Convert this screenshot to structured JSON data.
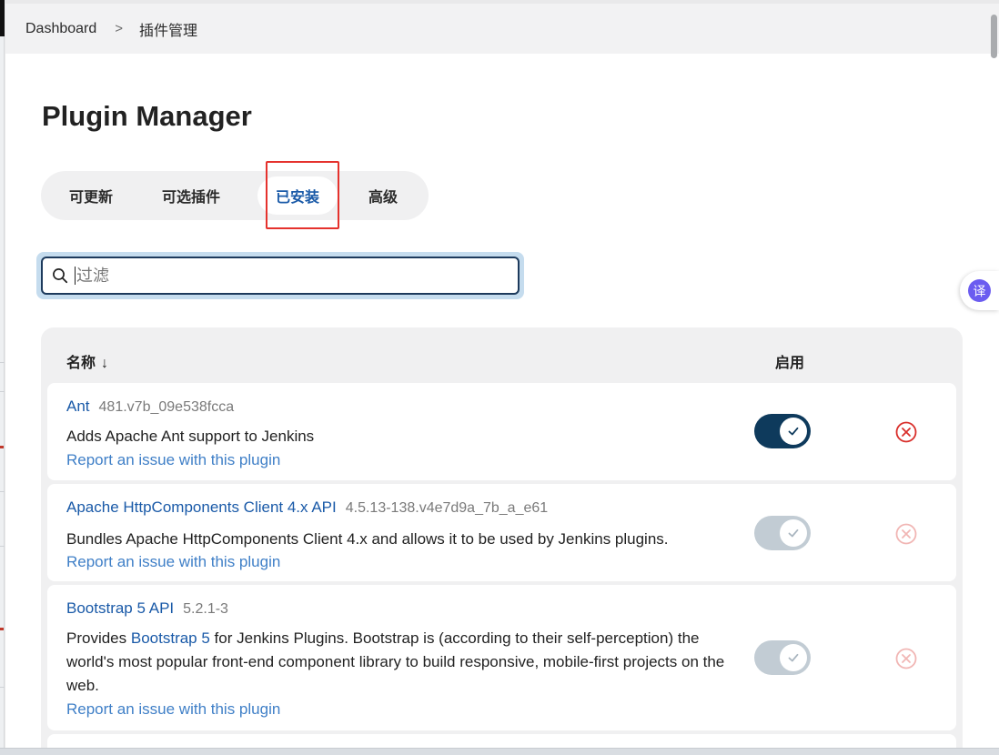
{
  "breadcrumb": {
    "items": [
      "Dashboard",
      "插件管理"
    ],
    "separator": ">"
  },
  "page": {
    "title": "Plugin Manager"
  },
  "tabs": [
    {
      "label": "可更新",
      "active": false
    },
    {
      "label": "可选插件",
      "active": false
    },
    {
      "label": "已安装",
      "active": true
    },
    {
      "label": "高级",
      "active": false
    }
  ],
  "search": {
    "value": "",
    "placeholder": "过滤",
    "icon": "search-icon"
  },
  "table": {
    "col_name": "名称",
    "sort_arrow": "↓",
    "col_enabled": "启用"
  },
  "plugins": [
    {
      "name": "Ant",
      "version": "481.v7b_09e538fcca",
      "description": "Adds Apache Ant support to Jenkins",
      "report": "Report an issue with this plugin",
      "enabled": true,
      "toggle_disabled": false
    },
    {
      "name": "Apache HttpComponents Client 4.x API",
      "version": "4.5.13-138.v4e7d9a_7b_a_e61",
      "description": "Bundles Apache HttpComponents Client 4.x and allows it to be used by Jenkins plugins.",
      "report": "Report an issue with this plugin",
      "enabled": true,
      "toggle_disabled": true
    },
    {
      "name": "Bootstrap 5 API",
      "version": "5.2.1-3",
      "description_prefix": "Provides ",
      "description_link": "Bootstrap 5",
      "description_suffix": " for Jenkins Plugins. Bootstrap is (according to their self-perception) the world's most popular front-end component library to build responsive, mobile-first projects on the web.",
      "report": "Report an issue with this plugin",
      "enabled": true,
      "toggle_disabled": true
    }
  ],
  "translate_button": {
    "label": "译"
  },
  "colors": {
    "link": "#1a5aa8",
    "toggle_on": "#0e3a5c",
    "toggle_disabled": "#c2ccd4",
    "uninstall": "#d9302c",
    "highlight": "#e5322d"
  }
}
